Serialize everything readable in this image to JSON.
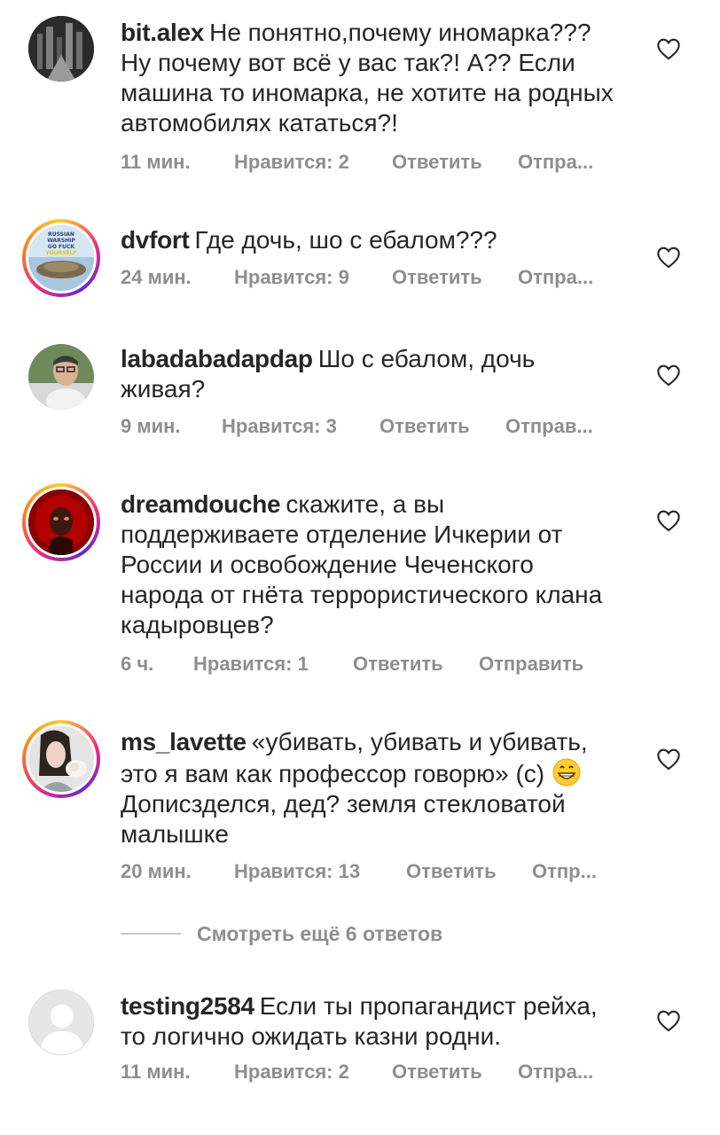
{
  "comments": [
    {
      "user": "bit.alex",
      "text": "Не понятно,почему иномарка??? Ну почему вот всё у вас так?! А?? Если машина то иномарка, не хотите на родных автомобилях кататься?!",
      "time": "11 мин.",
      "likes": "Нравится: 2",
      "reply": "Ответить",
      "send": "Отпра..."
    },
    {
      "user": "dvfort",
      "text": "Где дочь, шо с ебалом???",
      "time": "24 мин.",
      "likes": "Нравится: 9",
      "reply": "Ответить",
      "send": "Отпра..."
    },
    {
      "user": "labadabadapdap",
      "text": "Шо с ебалом, дочь живая?",
      "time": "9 мин.",
      "likes": "Нравится: 3",
      "reply": "Ответить",
      "send": "Отправ..."
    },
    {
      "user": "dreamdouche",
      "text": "скажите, а вы поддерживаете отделение Ичкерии от России и освобождение Чеченского народа от гнёта террористического клана кадыровцев?",
      "time": "6 ч.",
      "likes": "Нравится: 1",
      "reply": "Ответить",
      "send": "Отправить"
    },
    {
      "user": "ms_lavette",
      "text": "«убивать, убивать и убивать, это я вам как профессор говорю» (с)",
      "text_after": "Дописзделся, дед? земля стекловатой малышке",
      "time": "20 мин.",
      "likes": "Нравится: 13",
      "reply": "Ответить",
      "send": "Отпр..."
    },
    {
      "user": "testing2584",
      "text": "Если ты пропагандист рейха, то логично ожидать казни родни.",
      "time": "11 мин.",
      "likes": "Нравится: 2",
      "reply": "Ответить",
      "send": "Отпра..."
    }
  ],
  "view_more": "Смотреть ещё 6 ответов",
  "avatar_badge": {
    "line1": "RUSSIAN",
    "line2": "WARSHIP",
    "line3": "GO FUCK",
    "line4": "YOURSELF"
  },
  "colors": {
    "text": "#262626",
    "meta": "#8e8e8e",
    "heart": "#262626"
  }
}
